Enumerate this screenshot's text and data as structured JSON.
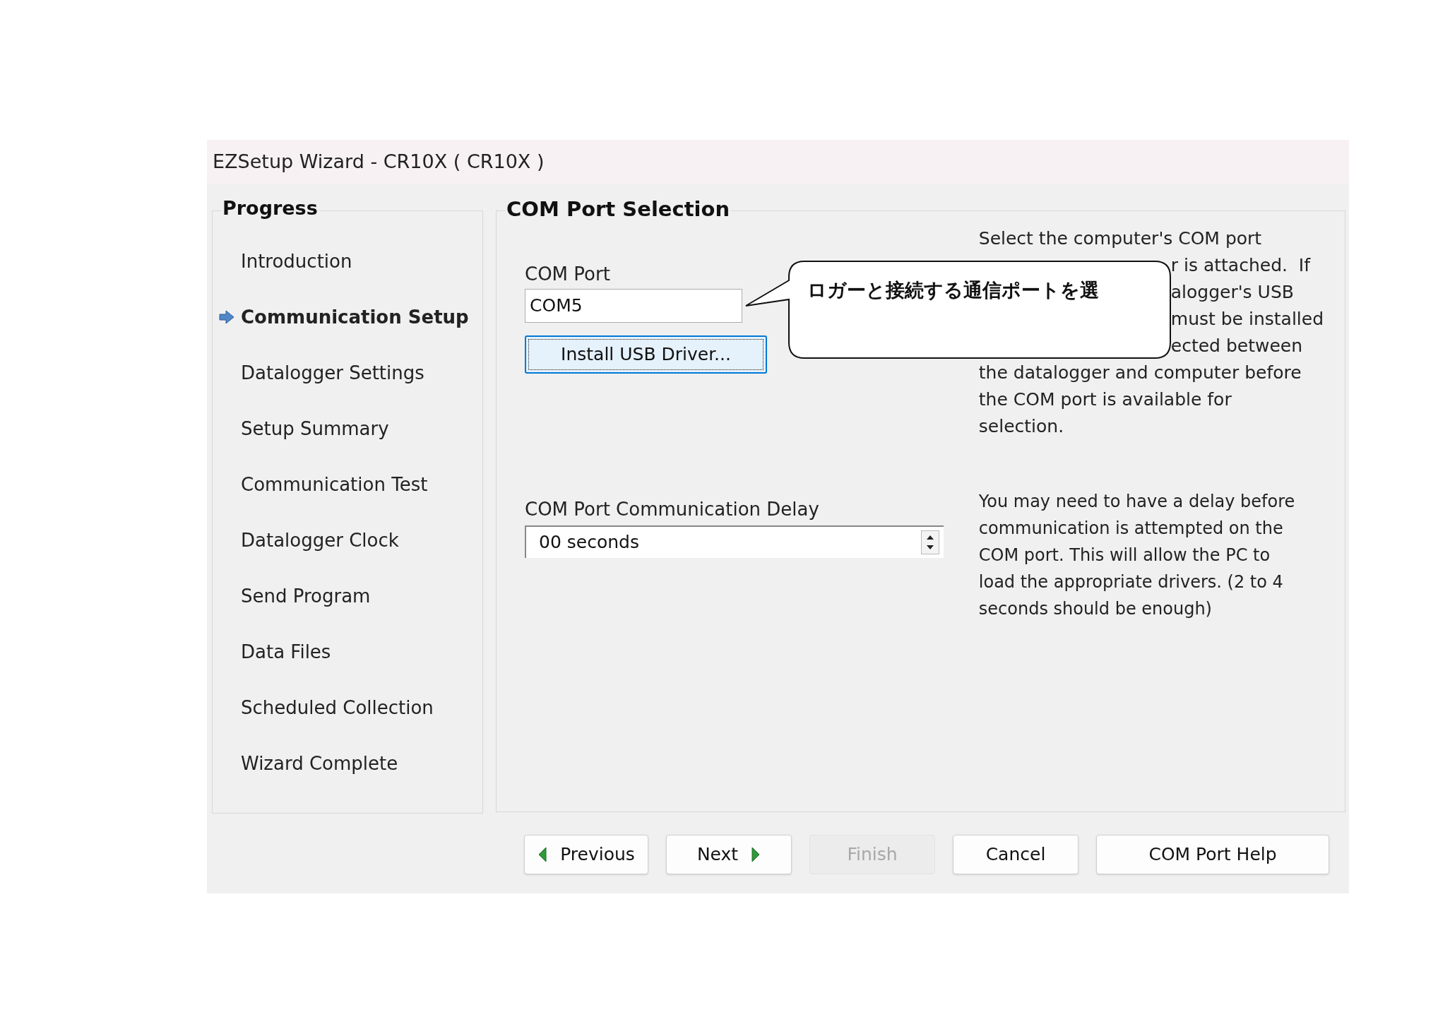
{
  "window": {
    "title": "EZSetup Wizard - CR10X ( CR10X )"
  },
  "progress": {
    "title": "Progress",
    "items": [
      {
        "label": "Introduction",
        "selected": false
      },
      {
        "label": "Communication Setup",
        "selected": true
      },
      {
        "label": "Datalogger Settings",
        "selected": false
      },
      {
        "label": "Setup Summary",
        "selected": false
      },
      {
        "label": "Communication Test",
        "selected": false
      },
      {
        "label": "Datalogger Clock",
        "selected": false
      },
      {
        "label": "Send Program",
        "selected": false
      },
      {
        "label": "Data Files",
        "selected": false
      },
      {
        "label": "Scheduled Collection",
        "selected": false
      },
      {
        "label": "Wizard Complete",
        "selected": false
      }
    ]
  },
  "page": {
    "title": "COM Port Selection",
    "com_port": {
      "label": "COM Port",
      "value": "COM5"
    },
    "install_button": "Install USB Driver...",
    "help_lines": [
      {
        "text": "Select the computer's COM port",
        "kind": "full"
      },
      {
        "text": "r is attached.  If",
        "kind": "partial"
      },
      {
        "text": "alogger's USB",
        "kind": "partial"
      },
      {
        "text": "must be installed",
        "kind": "partial"
      },
      {
        "text": "ected between",
        "kind": "partial"
      },
      {
        "text": "the datalogger and computer before",
        "kind": "full"
      },
      {
        "text": "the COM port is available for",
        "kind": "full"
      },
      {
        "text": "selection.",
        "kind": "full"
      }
    ],
    "delay": {
      "label": "COM Port Communication Delay",
      "value": "00 seconds"
    },
    "delay_help": "You may need to have a delay before communication is attempted on the COM port.  This will allow the PC to load the appropriate drivers. (2 to 4 seconds should be enough)"
  },
  "callout": {
    "text": "ロガーと接続する通信ポートを選"
  },
  "buttons": [
    {
      "label": "Previous",
      "kind": "previous",
      "disabled": false
    },
    {
      "label": "Next",
      "kind": "next",
      "disabled": false
    },
    {
      "label": "Finish",
      "kind": "plain",
      "disabled": true
    },
    {
      "label": "Cancel",
      "kind": "plain",
      "disabled": false
    },
    {
      "label": "COM Port Help",
      "kind": "wide",
      "disabled": false
    }
  ]
}
